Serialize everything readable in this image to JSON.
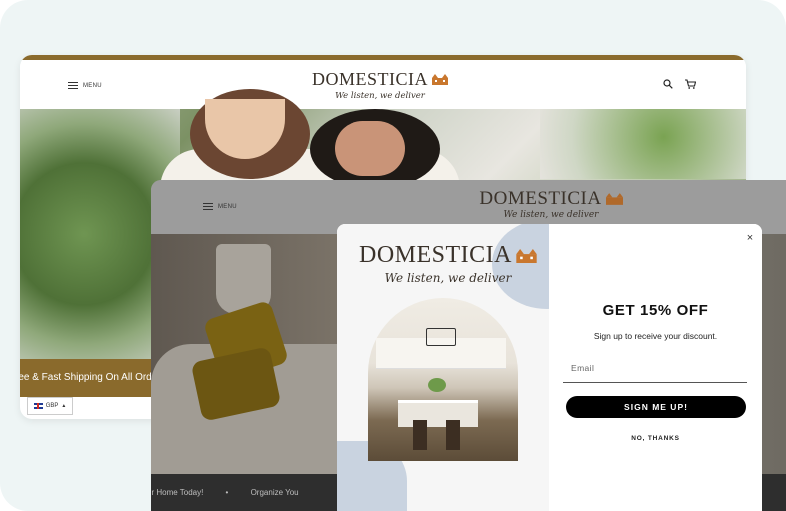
{
  "brand": {
    "name": "DOMESTICIA",
    "tagline": "We listen, we deliver"
  },
  "back_window": {
    "menu_label": "MENU",
    "shipping_banner": "ree & Fast Shipping On All Ord",
    "currency": "GBP"
  },
  "front_window": {
    "menu_label": "MENU",
    "bottom_bar": "ur Home Today!          •          Organize You"
  },
  "popup": {
    "headline": "GET 15% OFF",
    "subline": "Sign up to receive your discount.",
    "email_placeholder": "Email",
    "signup_label": "SIGN ME UP!",
    "decline_label": "NO, THANKS",
    "close_symbol": "×"
  },
  "colors": {
    "accent": "#8a6a2c",
    "deco_blue": "#c9d3e0",
    "button": "#000000"
  },
  "icons": [
    "hamburger-icon",
    "search-icon",
    "cart-icon",
    "house-logo-icon",
    "flag-uk-icon",
    "caret-up-icon",
    "close-icon"
  ]
}
